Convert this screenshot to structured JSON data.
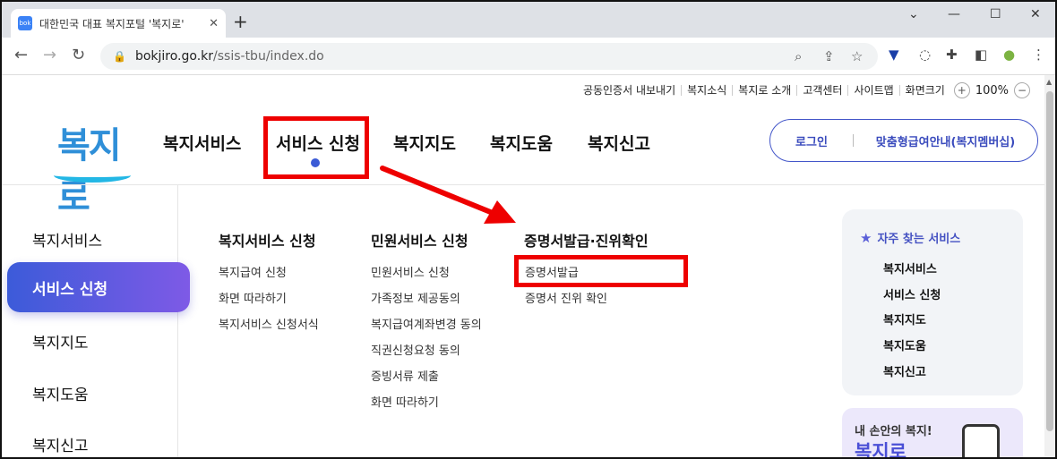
{
  "browser": {
    "tab_title": "대한민국 대표 복지포털 '복지로'",
    "tab_favicon": "bok",
    "tab_close": "✕",
    "new_tab": "+",
    "url_host": "bokjiro.go.kr",
    "url_path": "/ssis-tbu/index.do"
  },
  "utility": {
    "items": [
      "공동인증서 내보내기",
      "복지소식",
      "복지로 소개",
      "고객센터",
      "사이트맵",
      "화면크기"
    ],
    "zoom_in": "+",
    "zoom_value": "100%",
    "zoom_out": "−"
  },
  "logo": {
    "text": "복지로"
  },
  "gnb": {
    "items": [
      "복지서비스",
      "서비스 신청",
      "복지지도",
      "복지도움",
      "복지신고"
    ]
  },
  "header_cta": {
    "login": "로그인",
    "custom": "맞춤형급여안내(복지멤버십)"
  },
  "sidebar": {
    "items": [
      "복지서비스",
      "서비스 신청",
      "복지지도",
      "복지도움",
      "복지신고"
    ]
  },
  "menu": {
    "col1": {
      "title": "복지서비스 신청",
      "items": [
        "복지급여 신청",
        "화면 따라하기",
        "복지서비스 신청서식"
      ]
    },
    "col2": {
      "title": "민원서비스 신청",
      "items": [
        "민원서비스 신청",
        "가족정보 제공동의",
        "복지급여계좌변경 동의",
        "직권신청요청 동의",
        "증빙서류 제출",
        "화면 따라하기"
      ]
    },
    "col3": {
      "title": "증명서발급·진위확인",
      "items": [
        "증명서발급",
        "증명서 진위 확인"
      ]
    }
  },
  "favorites": {
    "title": "자주 찾는 서비스",
    "items": [
      "복지서비스",
      "서비스 신청",
      "복지지도",
      "복지도움",
      "복지신고"
    ]
  },
  "promo": {
    "sub": "내 손안의 복지!",
    "title": "복지로"
  },
  "colors": {
    "accent": "#3c5bd9",
    "highlight_red": "#e00000",
    "logo_blue": "#2f8fd8"
  }
}
